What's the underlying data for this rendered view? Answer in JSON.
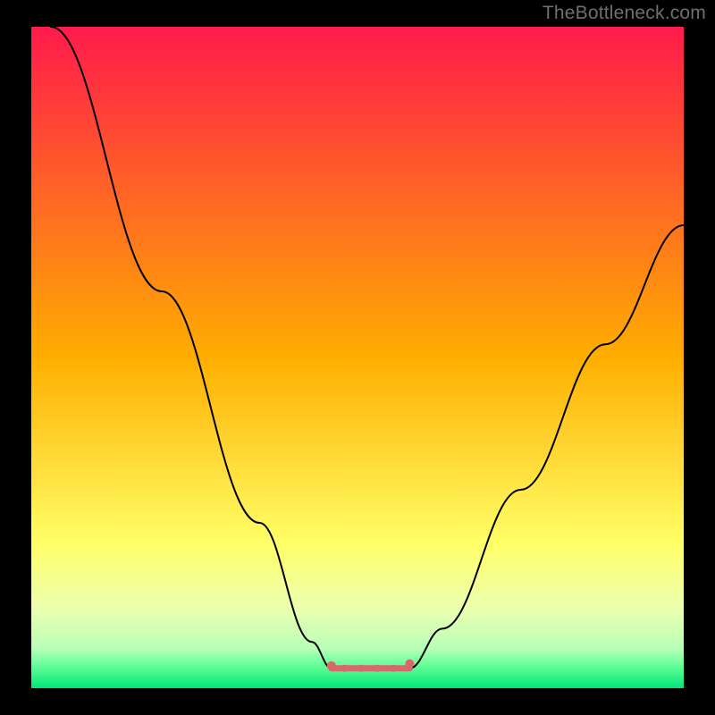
{
  "watermark": "TheBottleneck.com",
  "chart_data": {
    "type": "line",
    "title": "",
    "xlabel": "",
    "ylabel": "",
    "xlim": [
      0,
      100
    ],
    "ylim": [
      0,
      100
    ],
    "grid": false,
    "background_gradient": {
      "stops": [
        {
          "offset": 0.0,
          "color": "#ff1a4b"
        },
        {
          "offset": 0.5,
          "color": "#ffae00"
        },
        {
          "offset": 0.78,
          "color": "#ffff66"
        },
        {
          "offset": 0.88,
          "color": "#ecffb0"
        },
        {
          "offset": 0.94,
          "color": "#b8ffb8"
        },
        {
          "offset": 0.965,
          "color": "#66ff99"
        },
        {
          "offset": 1.0,
          "color": "#00e676"
        }
      ]
    },
    "series": [
      {
        "name": "left_curve",
        "color": "#000000",
        "stroke_width": 2,
        "points": [
          {
            "x": 3,
            "y": 100
          },
          {
            "x": 20,
            "y": 60
          },
          {
            "x": 35,
            "y": 25
          },
          {
            "x": 43,
            "y": 7
          },
          {
            "x": 46,
            "y": 3
          }
        ]
      },
      {
        "name": "right_curve",
        "color": "#000000",
        "stroke_width": 2,
        "points": [
          {
            "x": 58,
            "y": 3
          },
          {
            "x": 63,
            "y": 9
          },
          {
            "x": 75,
            "y": 30
          },
          {
            "x": 88,
            "y": 52
          },
          {
            "x": 100,
            "y": 70
          }
        ]
      },
      {
        "name": "flat_marker_band",
        "color": "#d66a6a",
        "stroke_width": 7,
        "points": [
          {
            "x": 46,
            "y": 3
          },
          {
            "x": 58,
            "y": 3
          }
        ]
      }
    ],
    "markers": [
      {
        "x": 46,
        "y": 3.4,
        "color": "#d66a6a",
        "r": 5
      },
      {
        "x": 48,
        "y": 3.0,
        "color": "#d66a6a",
        "r": 4
      },
      {
        "x": 50.5,
        "y": 3.0,
        "color": "#d66a6a",
        "r": 4
      },
      {
        "x": 53,
        "y": 3.0,
        "color": "#d66a6a",
        "r": 4
      },
      {
        "x": 55.5,
        "y": 3.0,
        "color": "#d66a6a",
        "r": 4
      },
      {
        "x": 58,
        "y": 3.7,
        "color": "#d66a6a",
        "r": 5
      }
    ]
  }
}
